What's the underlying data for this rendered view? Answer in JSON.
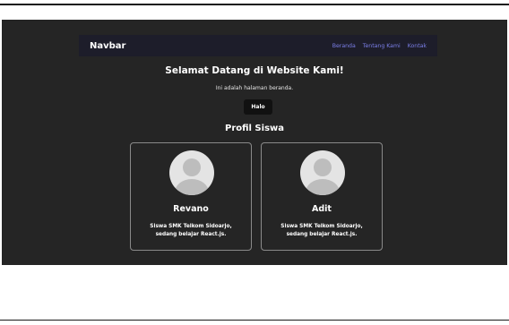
{
  "navbar": {
    "brand": "Navbar",
    "links": [
      "Beranda",
      "Tentang Kami",
      "Kontak"
    ]
  },
  "hero": {
    "title": "Selamat Datang di Website Kami!",
    "subtitle": "Ini adalah halaman beranda.",
    "button_label": "Halo"
  },
  "profiles": {
    "section_title": "Profil Siswa",
    "cards": [
      {
        "name": "Revano",
        "description": "Siswa SMK Telkom Sidoarjo, sedang belajar React.js."
      },
      {
        "name": "Adit",
        "description": "Siswa SMK Telkom Sidoarjo, sedang belajar React.js."
      }
    ]
  },
  "colors": {
    "page_background": "#252525",
    "navbar_background": "#1d1d2a",
    "link_color": "#7b7fe8",
    "card_border": "#8a8a8a"
  },
  "icons": {
    "avatar": "user-avatar-icon"
  }
}
